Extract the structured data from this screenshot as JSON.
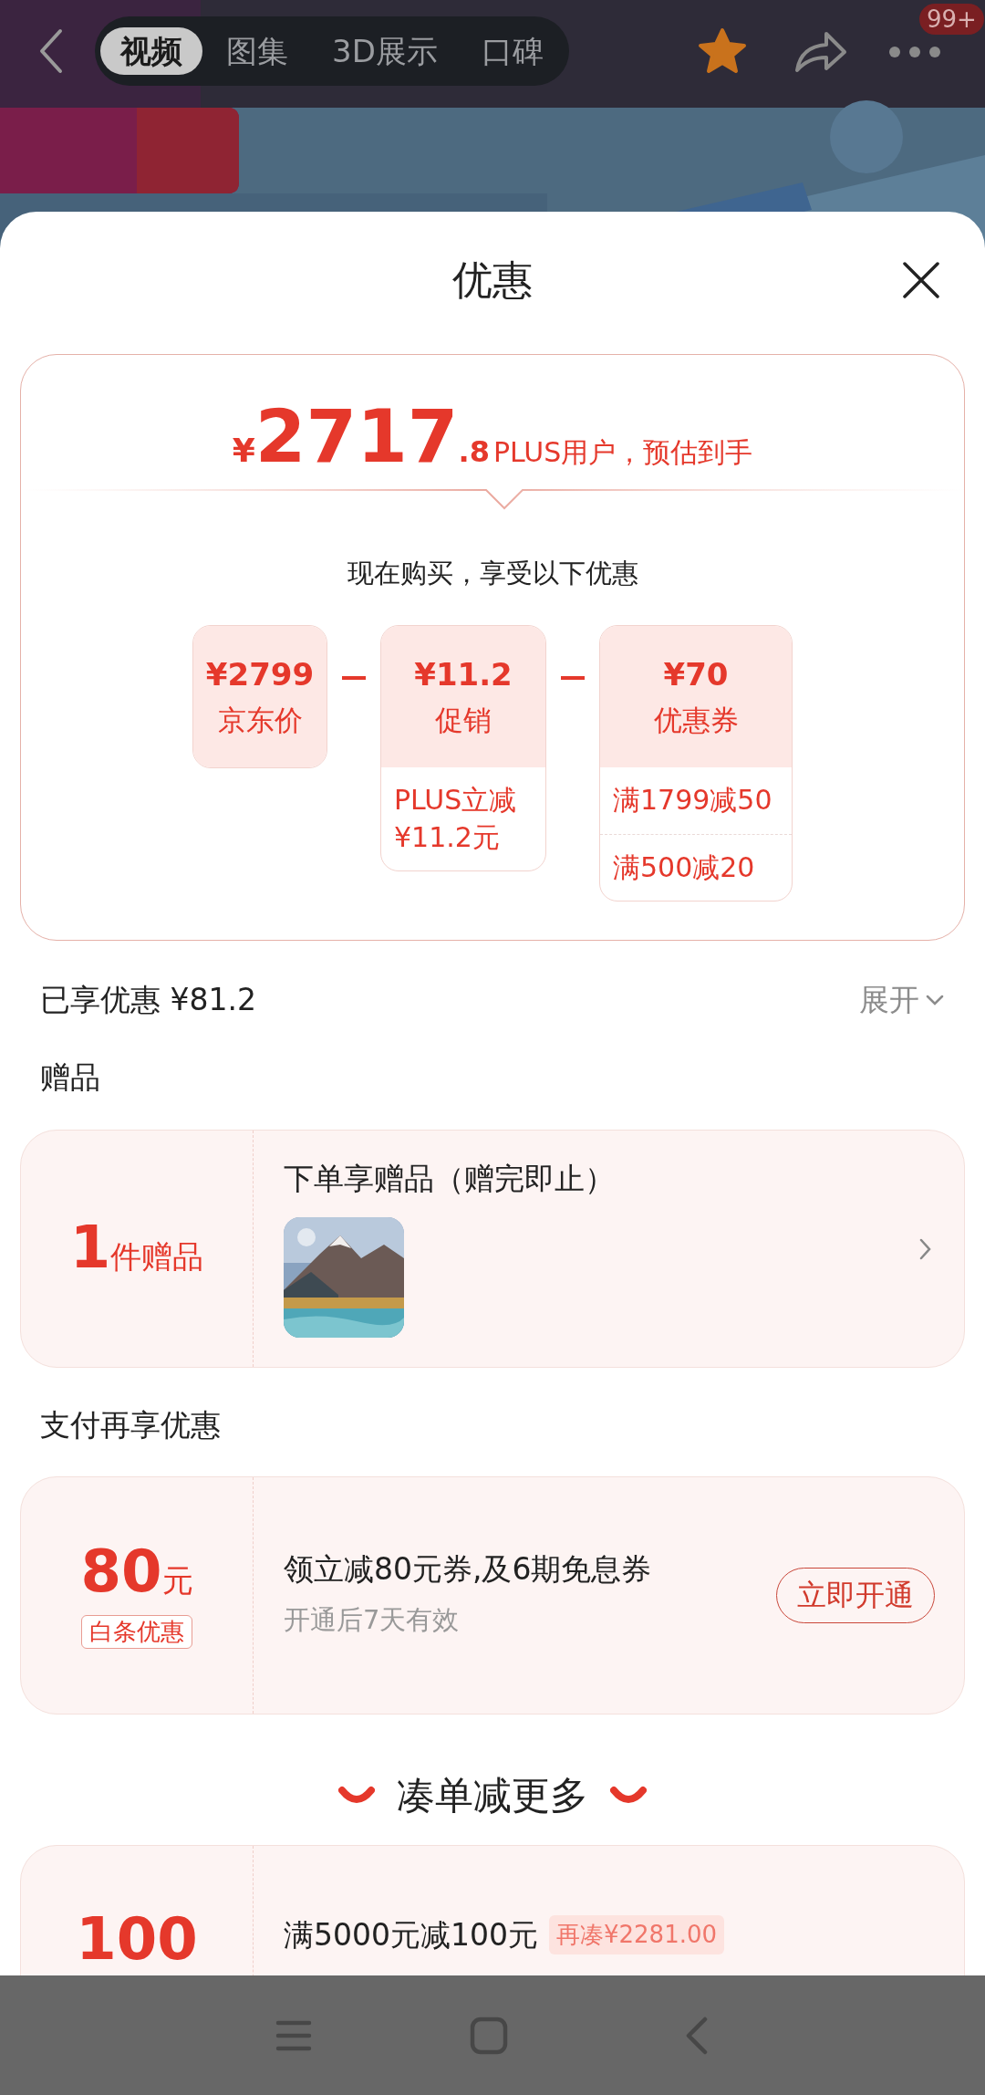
{
  "header": {
    "tabs": [
      {
        "label": "视频",
        "selected": true
      },
      {
        "label": "图集",
        "selected": false
      },
      {
        "label": "3D展示",
        "selected": false
      },
      {
        "label": "口碑",
        "selected": false
      }
    ],
    "badge": "99+"
  },
  "sheet": {
    "title": "优惠"
  },
  "price_card": {
    "currency": "¥",
    "price_int": "2717",
    "price_dec": ".8",
    "price_note": "PLUS用户，预估到手",
    "subtitle": "现在购买，享受以下优惠",
    "breakdown": [
      {
        "amount": "¥2799",
        "label": "京东价"
      },
      {
        "amount": "¥11.2",
        "label": "促销",
        "details": [
          "PLUS立减\n¥11.2元"
        ]
      },
      {
        "amount": "¥70",
        "label": "优惠券",
        "details": [
          "满1799减50",
          "满500减20"
        ]
      }
    ]
  },
  "saved": {
    "label": "已享优惠 ¥81.2",
    "toggle": "展开"
  },
  "gifts": {
    "heading": "赠品",
    "count": "1",
    "count_unit": "件赠品",
    "title": "下单享赠品（赠完即止）"
  },
  "payment": {
    "heading": "支付再享优惠",
    "amount": "80",
    "unit": "元",
    "tag": "白条优惠",
    "title": "领立减80元券,及6期免息券",
    "note": "开通后7天有效",
    "button": "立即开通"
  },
  "bundle": {
    "heading": "凑单减更多",
    "offers": [
      {
        "amount": "100",
        "title": "满5000元减100元",
        "tag": "再凑¥2281.00"
      }
    ]
  }
}
